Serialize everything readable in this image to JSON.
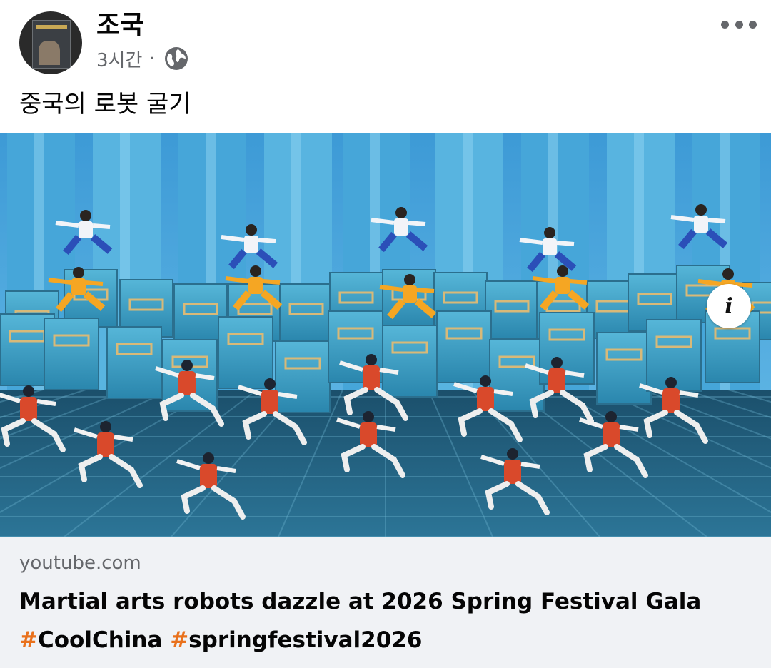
{
  "post": {
    "author": "조국",
    "time": "3시간",
    "separator": "·",
    "privacy_icon": "globe-icon",
    "text": "중국의 로봇 굴기",
    "more_icon": "more-options-icon"
  },
  "media": {
    "info_label": "i",
    "info_icon": "info-icon"
  },
  "link": {
    "domain": "youtube.com",
    "title": "Martial arts robots dazzle at 2026 Spring Festival Gala",
    "hashtags": [
      {
        "symbol": "#",
        "tag": "CoolChina"
      },
      {
        "symbol": "#",
        "tag": "springfestival2026"
      }
    ]
  },
  "colors": {
    "hashtag": "#e9711c",
    "meta": "#65676b",
    "link_bg": "#f0f2f5"
  }
}
